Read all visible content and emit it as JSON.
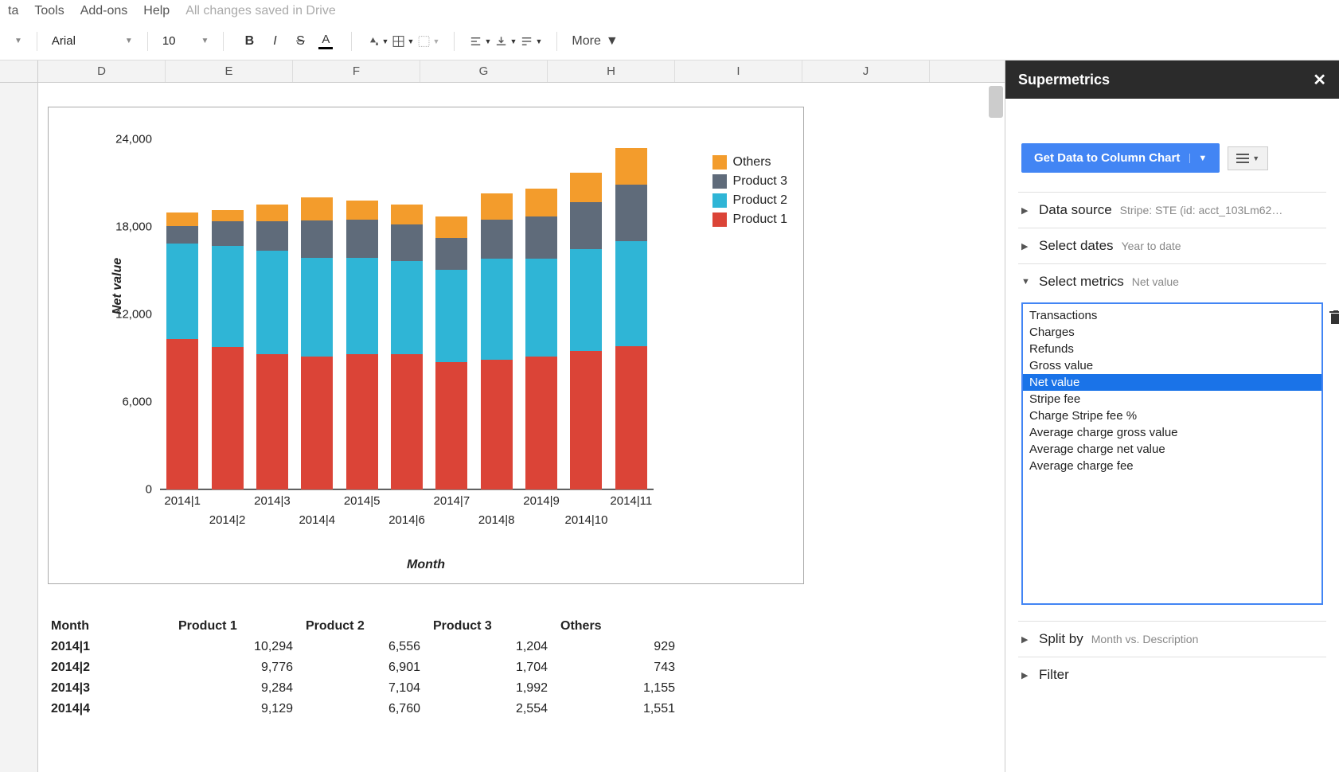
{
  "menubar": {
    "items": [
      "ta",
      "Tools",
      "Add-ons",
      "Help"
    ],
    "save_status": "All changes saved in Drive"
  },
  "toolbar": {
    "font": "Arial",
    "size": "10",
    "more": "More"
  },
  "columns": [
    "D",
    "E",
    "F",
    "G",
    "H",
    "I",
    "J"
  ],
  "chart_data": {
    "type": "bar",
    "ylabel": "Net value",
    "xlabel": "Month",
    "ylim": [
      0,
      24000
    ],
    "yticks": [
      0,
      6000,
      12000,
      18000,
      24000
    ],
    "ytick_labels": [
      "0",
      "6,000",
      "12,000",
      "18,000",
      "24,000"
    ],
    "categories": [
      "2014|1",
      "2014|2",
      "2014|3",
      "2014|4",
      "2014|5",
      "2014|6",
      "2014|7",
      "2014|8",
      "2014|9",
      "2014|10",
      "2014|11"
    ],
    "legend": [
      "Others",
      "Product 3",
      "Product 2",
      "Product 1"
    ],
    "colors": {
      "Product 1": "#db4437",
      "Product 2": "#2fb5d6",
      "Product 3": "#5f6b7a",
      "Others": "#f39c2c"
    },
    "series": [
      {
        "name": "Product 1",
        "values": [
          10294,
          9776,
          9284,
          9129,
          9300,
          9250,
          8750,
          8900,
          9100,
          9500,
          9800
        ]
      },
      {
        "name": "Product 2",
        "values": [
          6556,
          6901,
          7104,
          6760,
          6600,
          6400,
          6300,
          6900,
          6700,
          7000,
          7200
        ]
      },
      {
        "name": "Product 3",
        "values": [
          1204,
          1704,
          1992,
          2554,
          2600,
          2500,
          2200,
          2700,
          2900,
          3200,
          3900
        ]
      },
      {
        "name": "Others",
        "values": [
          929,
          743,
          1155,
          1551,
          1300,
          1400,
          1450,
          1800,
          1900,
          2000,
          2500
        ]
      }
    ]
  },
  "table": {
    "headers": [
      "Month",
      "Product 1",
      "Product 2",
      "Product 3",
      "Others"
    ],
    "rows": [
      [
        "2014|1",
        "10,294",
        "6,556",
        "1,204",
        "929"
      ],
      [
        "2014|2",
        "9,776",
        "6,901",
        "1,704",
        "743"
      ],
      [
        "2014|3",
        "9,284",
        "7,104",
        "1,992",
        "1,155"
      ],
      [
        "2014|4",
        "9,129",
        "6,760",
        "2,554",
        "1,551"
      ]
    ]
  },
  "sidebar": {
    "title": "Supermetrics",
    "main_button": "Get Data to Column Chart",
    "sections": {
      "data_source": {
        "title": "Data source",
        "sub": "Stripe: STE (id: acct_103Lm62…"
      },
      "select_dates": {
        "title": "Select dates",
        "sub": "Year to date"
      },
      "select_metrics": {
        "title": "Select metrics",
        "sub": "Net value"
      },
      "split_by": {
        "title": "Split by",
        "sub": "Month vs. Description"
      },
      "filter": {
        "title": "Filter",
        "sub": ""
      }
    },
    "metrics": [
      "Transactions",
      "Charges",
      "Refunds",
      "Gross value",
      "Net value",
      "Stripe fee",
      "Charge Stripe fee %",
      "Average charge gross value",
      "Average charge net value",
      "Average charge fee"
    ],
    "selected_metric": "Net value"
  }
}
